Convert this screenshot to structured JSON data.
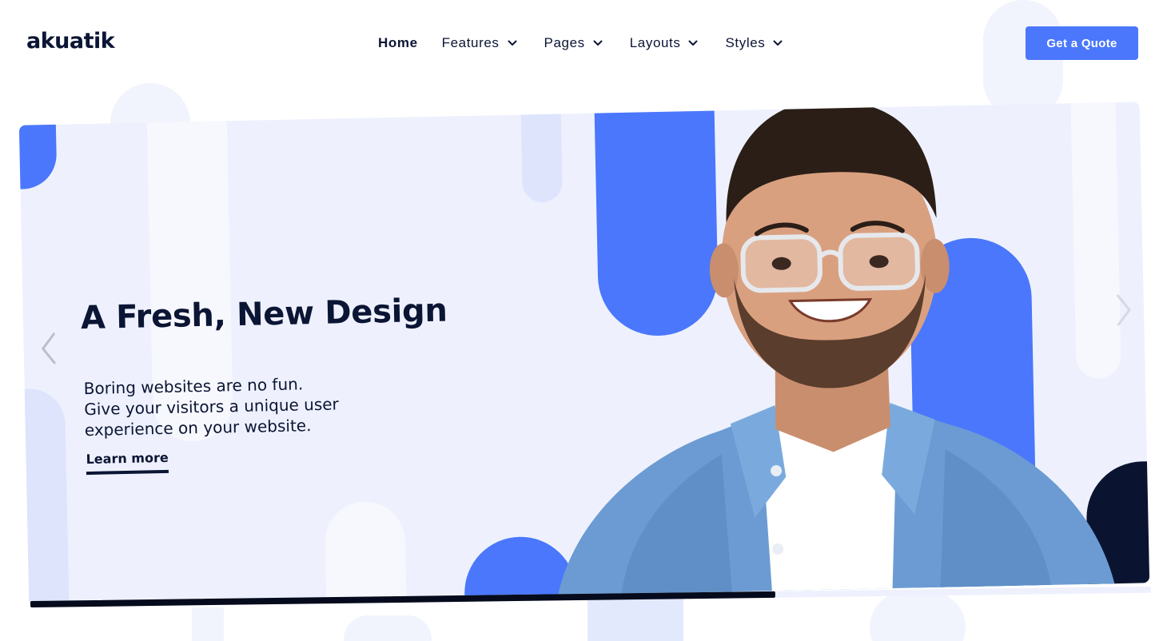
{
  "header": {
    "logo": "akuatik",
    "nav": [
      {
        "label": "Home",
        "active": true,
        "dropdown": false
      },
      {
        "label": "Features",
        "active": false,
        "dropdown": true
      },
      {
        "label": "Pages",
        "active": false,
        "dropdown": true
      },
      {
        "label": "Layouts",
        "active": false,
        "dropdown": true
      },
      {
        "label": "Styles",
        "active": false,
        "dropdown": true
      }
    ],
    "cta": "Get a Quote"
  },
  "hero": {
    "title": "A Fresh, New Design",
    "text_lines": [
      "Boring websites are no fun.",
      "Give your visitors a unique user",
      "experience on your website."
    ],
    "link": "Learn more"
  },
  "slider": {
    "progress": 0.665
  },
  "icons": {
    "prev": "chevron-left-icon",
    "next": "chevron-right-icon",
    "nav_dropdown": "chevron-down-icon"
  },
  "colors": {
    "accent": "#4a77fb",
    "dark": "#0b1534",
    "hero_bg": "#eef1fd",
    "navy": "#0a1430"
  }
}
